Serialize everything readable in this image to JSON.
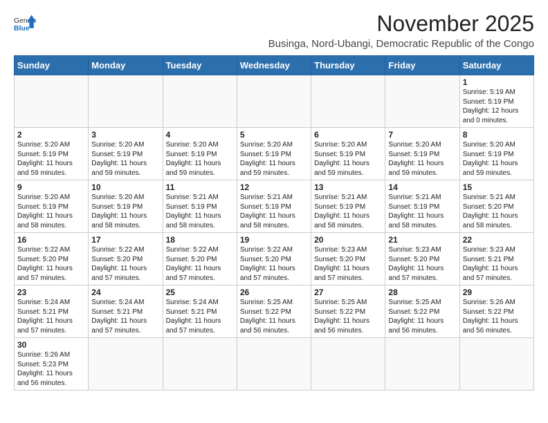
{
  "header": {
    "logo_general": "General",
    "logo_blue": "Blue",
    "month": "November 2025",
    "location": "Businga, Nord-Ubangi, Democratic Republic of the Congo"
  },
  "weekdays": [
    "Sunday",
    "Monday",
    "Tuesday",
    "Wednesday",
    "Thursday",
    "Friday",
    "Saturday"
  ],
  "weeks": [
    [
      {
        "day": "",
        "detail": ""
      },
      {
        "day": "",
        "detail": ""
      },
      {
        "day": "",
        "detail": ""
      },
      {
        "day": "",
        "detail": ""
      },
      {
        "day": "",
        "detail": ""
      },
      {
        "day": "",
        "detail": ""
      },
      {
        "day": "1",
        "detail": "Sunrise: 5:19 AM\nSunset: 5:19 PM\nDaylight: 12 hours\nand 0 minutes."
      }
    ],
    [
      {
        "day": "2",
        "detail": "Sunrise: 5:20 AM\nSunset: 5:19 PM\nDaylight: 11 hours\nand 59 minutes."
      },
      {
        "day": "3",
        "detail": "Sunrise: 5:20 AM\nSunset: 5:19 PM\nDaylight: 11 hours\nand 59 minutes."
      },
      {
        "day": "4",
        "detail": "Sunrise: 5:20 AM\nSunset: 5:19 PM\nDaylight: 11 hours\nand 59 minutes."
      },
      {
        "day": "5",
        "detail": "Sunrise: 5:20 AM\nSunset: 5:19 PM\nDaylight: 11 hours\nand 59 minutes."
      },
      {
        "day": "6",
        "detail": "Sunrise: 5:20 AM\nSunset: 5:19 PM\nDaylight: 11 hours\nand 59 minutes."
      },
      {
        "day": "7",
        "detail": "Sunrise: 5:20 AM\nSunset: 5:19 PM\nDaylight: 11 hours\nand 59 minutes."
      },
      {
        "day": "8",
        "detail": "Sunrise: 5:20 AM\nSunset: 5:19 PM\nDaylight: 11 hours\nand 59 minutes."
      }
    ],
    [
      {
        "day": "9",
        "detail": "Sunrise: 5:20 AM\nSunset: 5:19 PM\nDaylight: 11 hours\nand 58 minutes."
      },
      {
        "day": "10",
        "detail": "Sunrise: 5:20 AM\nSunset: 5:19 PM\nDaylight: 11 hours\nand 58 minutes."
      },
      {
        "day": "11",
        "detail": "Sunrise: 5:21 AM\nSunset: 5:19 PM\nDaylight: 11 hours\nand 58 minutes."
      },
      {
        "day": "12",
        "detail": "Sunrise: 5:21 AM\nSunset: 5:19 PM\nDaylight: 11 hours\nand 58 minutes."
      },
      {
        "day": "13",
        "detail": "Sunrise: 5:21 AM\nSunset: 5:19 PM\nDaylight: 11 hours\nand 58 minutes."
      },
      {
        "day": "14",
        "detail": "Sunrise: 5:21 AM\nSunset: 5:19 PM\nDaylight: 11 hours\nand 58 minutes."
      },
      {
        "day": "15",
        "detail": "Sunrise: 5:21 AM\nSunset: 5:20 PM\nDaylight: 11 hours\nand 58 minutes."
      }
    ],
    [
      {
        "day": "16",
        "detail": "Sunrise: 5:22 AM\nSunset: 5:20 PM\nDaylight: 11 hours\nand 57 minutes."
      },
      {
        "day": "17",
        "detail": "Sunrise: 5:22 AM\nSunset: 5:20 PM\nDaylight: 11 hours\nand 57 minutes."
      },
      {
        "day": "18",
        "detail": "Sunrise: 5:22 AM\nSunset: 5:20 PM\nDaylight: 11 hours\nand 57 minutes."
      },
      {
        "day": "19",
        "detail": "Sunrise: 5:22 AM\nSunset: 5:20 PM\nDaylight: 11 hours\nand 57 minutes."
      },
      {
        "day": "20",
        "detail": "Sunrise: 5:23 AM\nSunset: 5:20 PM\nDaylight: 11 hours\nand 57 minutes."
      },
      {
        "day": "21",
        "detail": "Sunrise: 5:23 AM\nSunset: 5:20 PM\nDaylight: 11 hours\nand 57 minutes."
      },
      {
        "day": "22",
        "detail": "Sunrise: 5:23 AM\nSunset: 5:21 PM\nDaylight: 11 hours\nand 57 minutes."
      }
    ],
    [
      {
        "day": "23",
        "detail": "Sunrise: 5:24 AM\nSunset: 5:21 PM\nDaylight: 11 hours\nand 57 minutes."
      },
      {
        "day": "24",
        "detail": "Sunrise: 5:24 AM\nSunset: 5:21 PM\nDaylight: 11 hours\nand 57 minutes."
      },
      {
        "day": "25",
        "detail": "Sunrise: 5:24 AM\nSunset: 5:21 PM\nDaylight: 11 hours\nand 57 minutes."
      },
      {
        "day": "26",
        "detail": "Sunrise: 5:25 AM\nSunset: 5:22 PM\nDaylight: 11 hours\nand 56 minutes."
      },
      {
        "day": "27",
        "detail": "Sunrise: 5:25 AM\nSunset: 5:22 PM\nDaylight: 11 hours\nand 56 minutes."
      },
      {
        "day": "28",
        "detail": "Sunrise: 5:25 AM\nSunset: 5:22 PM\nDaylight: 11 hours\nand 56 minutes."
      },
      {
        "day": "29",
        "detail": "Sunrise: 5:26 AM\nSunset: 5:22 PM\nDaylight: 11 hours\nand 56 minutes."
      }
    ],
    [
      {
        "day": "30",
        "detail": "Sunrise: 5:26 AM\nSunset: 5:23 PM\nDaylight: 11 hours\nand 56 minutes."
      },
      {
        "day": "",
        "detail": ""
      },
      {
        "day": "",
        "detail": ""
      },
      {
        "day": "",
        "detail": ""
      },
      {
        "day": "",
        "detail": ""
      },
      {
        "day": "",
        "detail": ""
      },
      {
        "day": "",
        "detail": ""
      }
    ]
  ]
}
